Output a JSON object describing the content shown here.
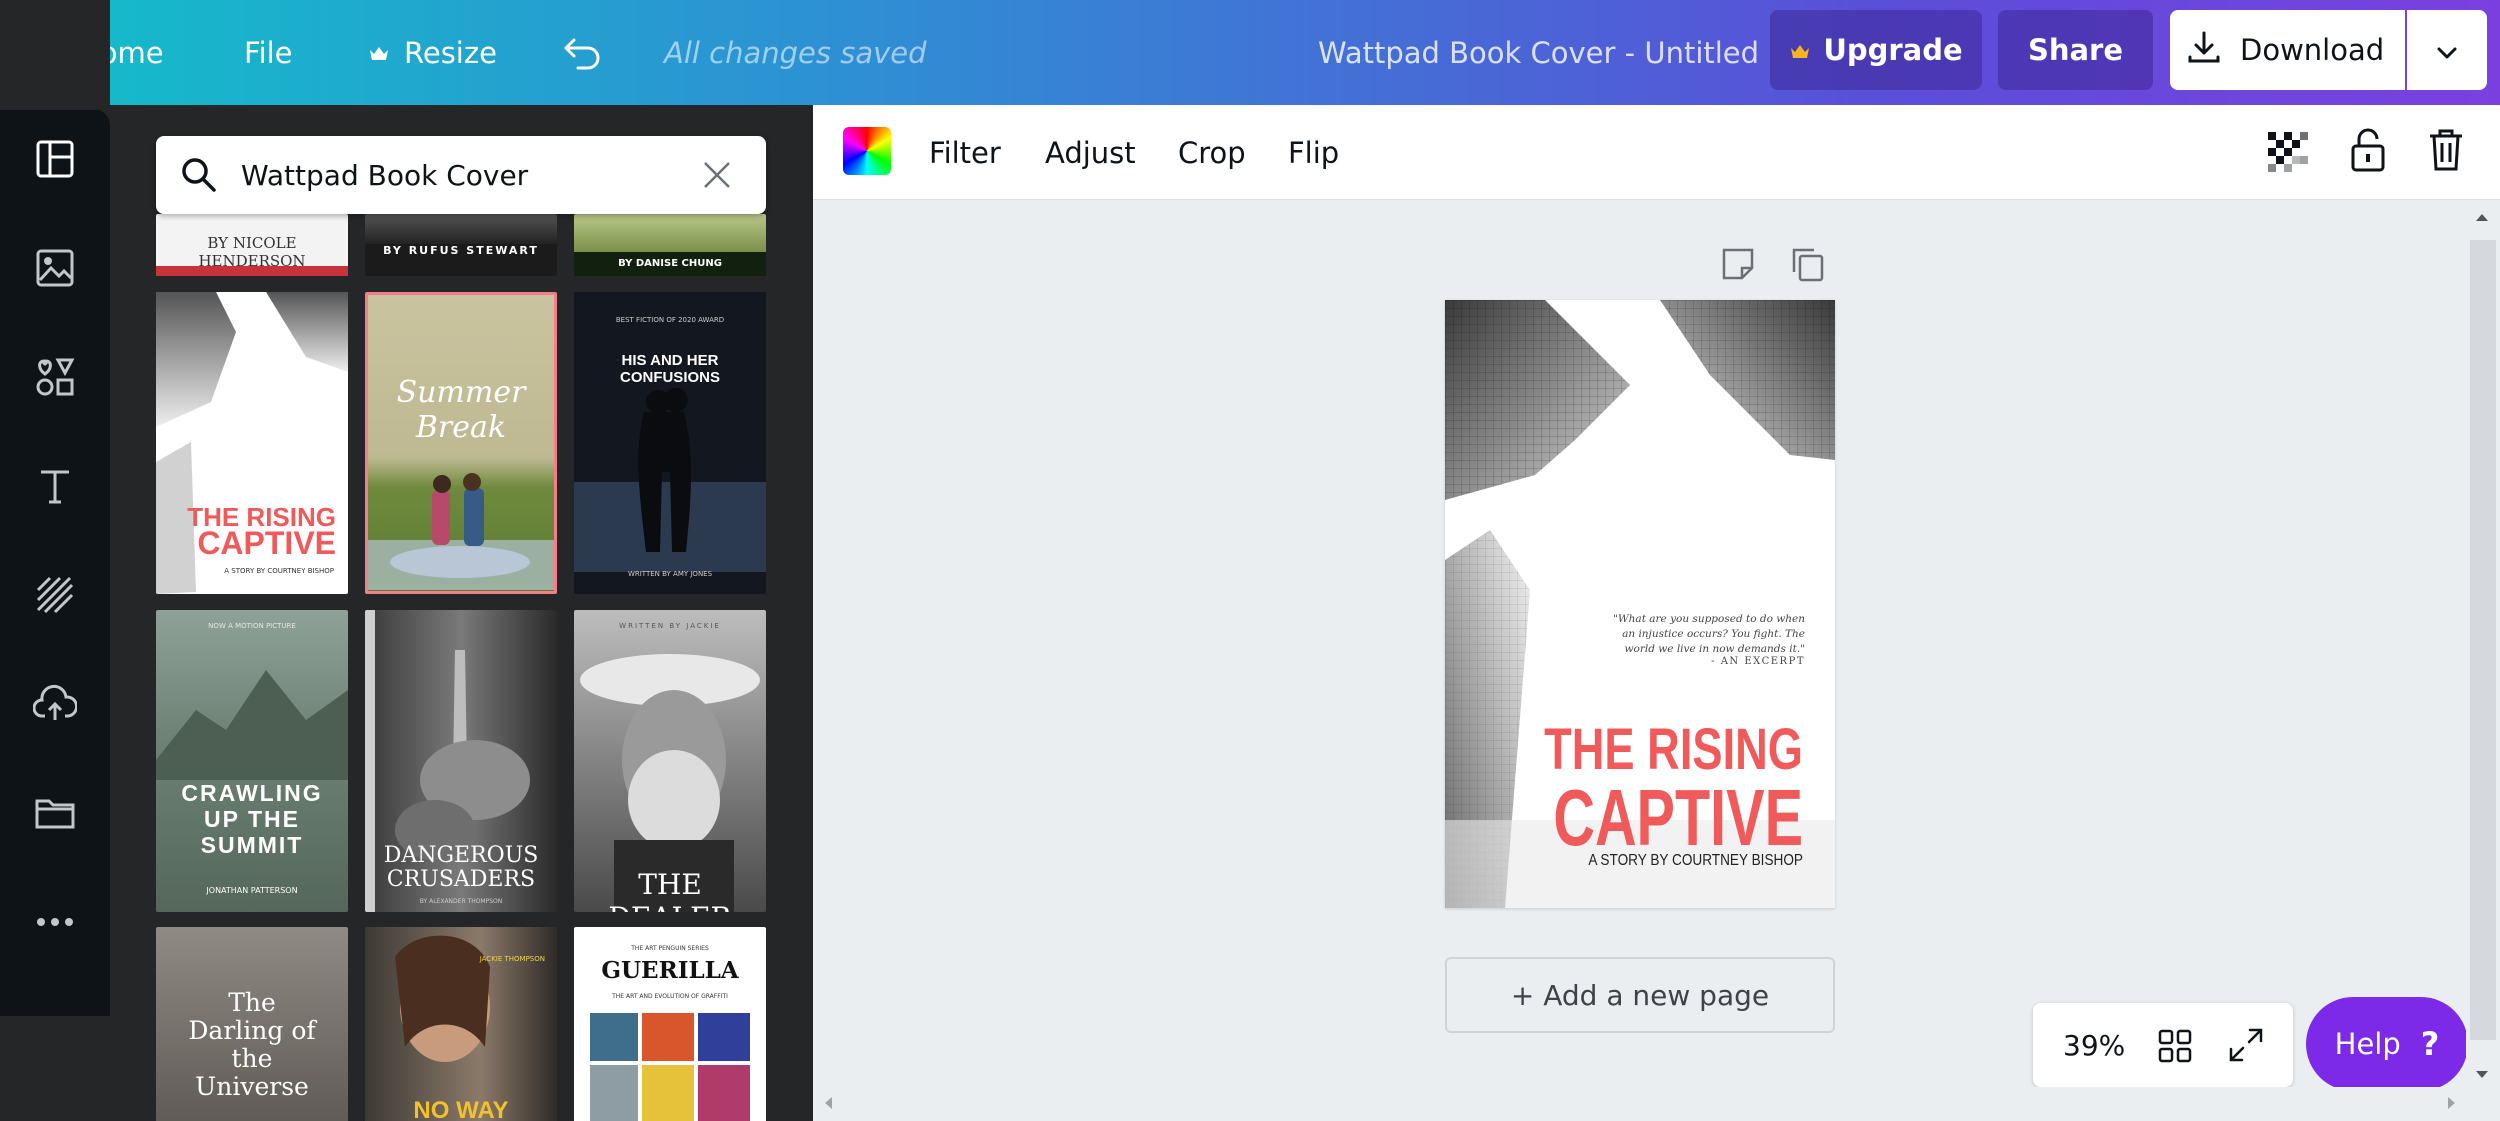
{
  "topbar": {
    "home_label": "Home",
    "file_label": "File",
    "resize_label": "Resize",
    "saved_status": "All changes saved",
    "doc_title": "Wattpad Book Cover - Untitled",
    "upgrade_label": "Upgrade",
    "share_label": "Share",
    "download_label": "Download"
  },
  "sidebar": {
    "search_value": "Wattpad Book Cover",
    "rail_icons": [
      "templates-icon",
      "photos-icon",
      "elements-icon",
      "text-icon",
      "backgrounds-icon",
      "uploads-icon",
      "folders-icon",
      "more-icon"
    ]
  },
  "templates": [
    {
      "title": "",
      "byline": "BY NICOLE HENDERSON"
    },
    {
      "title": "",
      "byline": "BY RUFUS STEWART"
    },
    {
      "title": "",
      "byline": "BY DANISE CHUNG"
    },
    {
      "title_line1": "THE RISING",
      "title_line2": "CAPTIVE",
      "byline": "A STORY BY COURTNEY BISHOP"
    },
    {
      "title": "Summer Break"
    },
    {
      "top": "BEST FICTION OF 2020 AWARD",
      "title": "HIS AND HER CONFUSIONS",
      "byline": "WRITTEN BY AMY JONES"
    },
    {
      "top": "NOW A MOTION PICTURE",
      "title": "CRAWLING UP THE SUMMIT",
      "byline": "JONATHAN PATTERSON"
    },
    {
      "title": "DANGEROUS CRUSADERS",
      "byline": "BY ALEXANDER THOMPSON"
    },
    {
      "top": "WRITTEN BY JACKIE",
      "title": "THE DEALER"
    },
    {
      "title": "The Darling of the Universe"
    },
    {
      "top": "JACKIE THOMPSON",
      "title": "NO WAY"
    },
    {
      "top": "THE ART PENGUIN SERIES",
      "title": "GUERILLA",
      "subtitle": "THE ART AND EVOLUTION OF GRAFFITI"
    }
  ],
  "toolbar": {
    "filter_label": "Filter",
    "adjust_label": "Adjust",
    "crop_label": "Crop",
    "flip_label": "Flip"
  },
  "design": {
    "quote_line1": "\"What are you supposed to do when",
    "quote_line2": "an injustice occurs? You fight. The",
    "quote_line3": "world we live in now demands it.\"",
    "excerpt_label": "- AN EXCERPT",
    "title_line1": "THE RISING",
    "title_line2": "CAPTIVE",
    "author": "A STORY BY COURTNEY BISHOP",
    "accent_color": "#f05a5b"
  },
  "canvas": {
    "add_page_label": "+ Add a new page",
    "zoom_label": "39%",
    "help_label": "Help",
    "help_glyph": "?"
  }
}
